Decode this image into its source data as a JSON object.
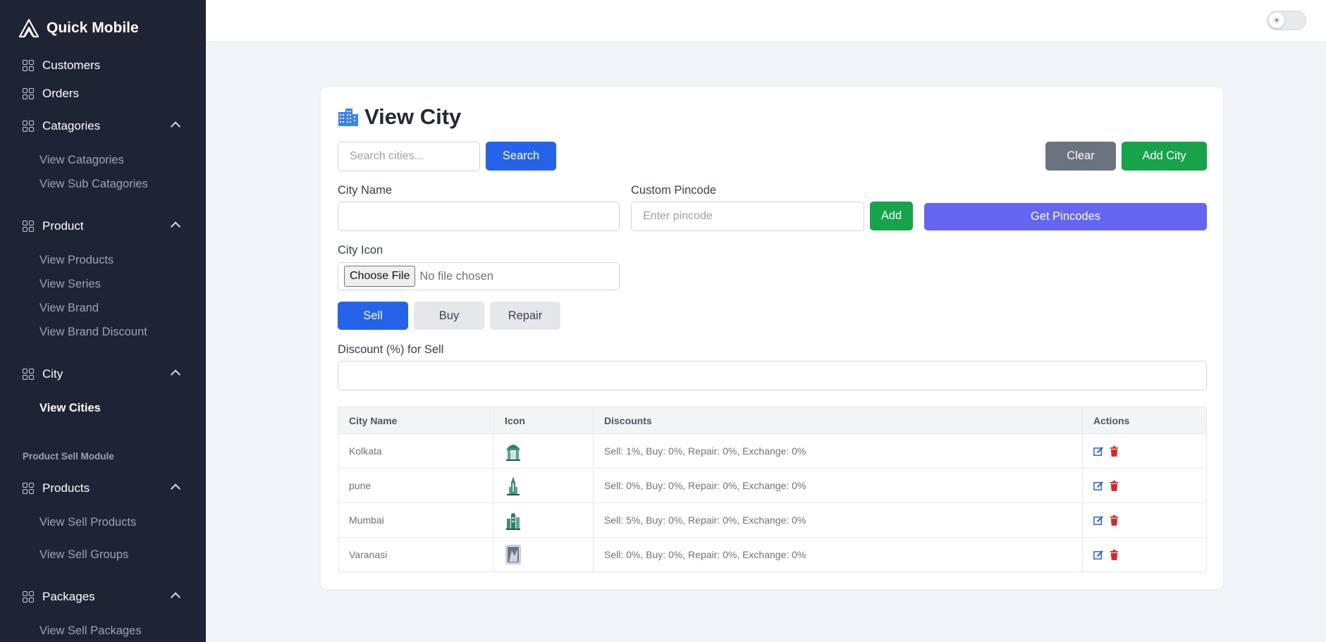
{
  "app": {
    "name": "Quick Mobile"
  },
  "sidebar": {
    "customers": "Customers",
    "orders": "Orders",
    "catagories": {
      "label": "Catagories",
      "items": [
        "View Catagories",
        "View Sub Catagories"
      ]
    },
    "product": {
      "label": "Product",
      "items": [
        "View Products",
        "View Series",
        "View Brand",
        "View Brand Discount"
      ]
    },
    "city": {
      "label": "City",
      "items": [
        "View Cities"
      ]
    },
    "section_label": "Product Sell Module",
    "products": {
      "label": "Products",
      "items": [
        "View Sell Products",
        "View Sell Groups"
      ]
    },
    "packages": {
      "label": "Packages",
      "items": [
        "View Sell Packages"
      ]
    }
  },
  "page": {
    "title": "View City"
  },
  "search": {
    "placeholder": "Search cities...",
    "button": "Search",
    "clear": "Clear",
    "add_city": "Add City"
  },
  "form": {
    "city_name_label": "City Name",
    "city_name_value": "",
    "pincode_label": "Custom Pincode",
    "pincode_placeholder": "Enter pincode",
    "add_button": "Add",
    "get_pincodes": "Get Pincodes",
    "icon_label": "City Icon",
    "choose_file": "Choose File",
    "no_file": "No file chosen",
    "tabs": [
      "Sell",
      "Buy",
      "Repair"
    ],
    "active_tab": "Sell",
    "discount_label": "Discount (%) for Sell",
    "discount_value": ""
  },
  "table": {
    "headers": [
      "City Name",
      "Icon",
      "Discounts",
      "Actions"
    ],
    "rows": [
      {
        "city": "Kolkata",
        "icon": "kolkata-monument-icon",
        "discounts": "Sell: 1%, Buy: 0%, Repair: 0%, Exchange: 0%"
      },
      {
        "city": "pune",
        "icon": "pune-tower-icon",
        "discounts": "Sell: 0%, Buy: 0%, Repair: 0%, Exchange: 0%"
      },
      {
        "city": "Mumbai",
        "icon": "mumbai-skyline-icon",
        "discounts": "Sell: 5%, Buy: 0%, Repair: 0%, Exchange: 0%"
      },
      {
        "city": "Varanasi",
        "icon": "varanasi-photo-icon",
        "discounts": "Sell: 0%, Buy: 0%, Repair: 0%, Exchange: 0%"
      }
    ]
  },
  "colors": {
    "sidebar_bg": "#1e2433",
    "primary": "#2563eb",
    "success": "#16a34a",
    "secondary": "#6b7280",
    "indigo": "#6366f1",
    "danger": "#dc2626"
  }
}
